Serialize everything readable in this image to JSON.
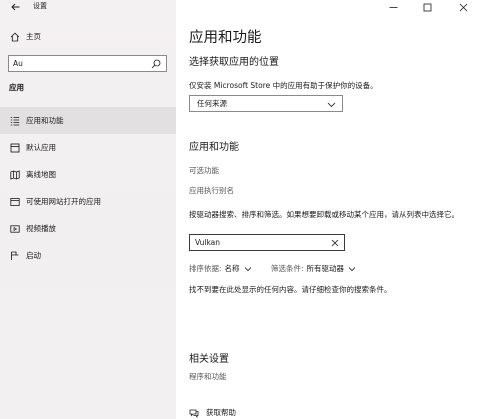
{
  "window": {
    "app_title": "设置",
    "controls": {
      "minimize": "—",
      "maximize": "☐",
      "close": "✕"
    }
  },
  "sidebar": {
    "home_label": "主页",
    "search": {
      "value": "Au",
      "placeholder": ""
    },
    "section_title": "应用",
    "items": [
      {
        "label": "应用和功能",
        "icon": "apps-features-icon",
        "selected": true
      },
      {
        "label": "默认应用",
        "icon": "default-apps-icon",
        "selected": false
      },
      {
        "label": "离线地图",
        "icon": "offline-maps-icon",
        "selected": false
      },
      {
        "label": "可使用网站打开的应用",
        "icon": "apps-for-websites-icon",
        "selected": false
      },
      {
        "label": "视频播放",
        "icon": "video-playback-icon",
        "selected": false
      },
      {
        "label": "启动",
        "icon": "startup-icon",
        "selected": false
      }
    ]
  },
  "main": {
    "title": "应用和功能",
    "install_section": {
      "heading": "选择获取应用的位置",
      "description": "仅安装 Microsoft Store 中的应用有助于保护你的设备。",
      "dropdown_value": "任何来源"
    },
    "apps_section": {
      "heading": "应用和功能",
      "optional_features_link": "可选功能",
      "app_alias_link": "应用执行别名",
      "description": "按驱动器搜索、排序和筛选。如果想要卸载或移动某个应用，请从列表中选择它。",
      "filter": {
        "value": "Vulkan",
        "placeholder": ""
      },
      "sort": {
        "label": "排序依据:",
        "value": "名称"
      },
      "filter_by": {
        "label": "筛选条件:",
        "value": "所有驱动器"
      },
      "not_found": "找不到要在此处显示的任何内容。请仔细检查你的搜索条件。"
    },
    "related": {
      "heading": "相关设置",
      "link": "程序和功能"
    },
    "help": {
      "label": "获取帮助"
    }
  },
  "colors": {
    "sidebar_bg": "#f2f0f1",
    "selected_bg": "#e2e0e1",
    "link_gray": "#555555",
    "text": "#1a1a1a"
  }
}
